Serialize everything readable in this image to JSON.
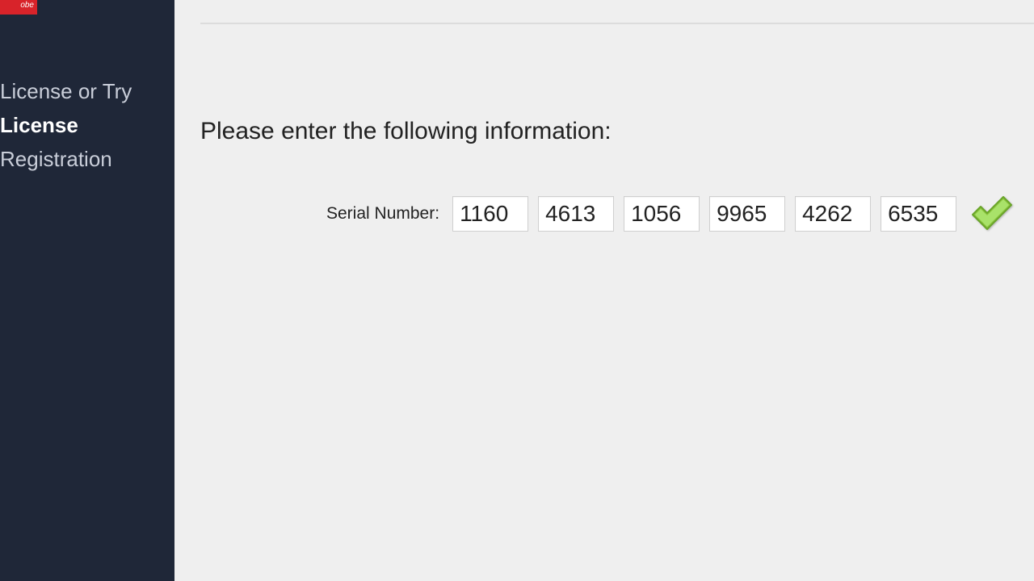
{
  "logo_text": "obe",
  "sidebar": {
    "items": [
      {
        "label": "License or Try",
        "active": false
      },
      {
        "label": "License",
        "active": true
      },
      {
        "label": "Registration",
        "active": false
      }
    ]
  },
  "main": {
    "prompt": "Please enter the following information:",
    "serial_label": "Serial Number:",
    "serial_fields": [
      "1160",
      "4613",
      "1056",
      "9965",
      "4262",
      "6535"
    ]
  }
}
